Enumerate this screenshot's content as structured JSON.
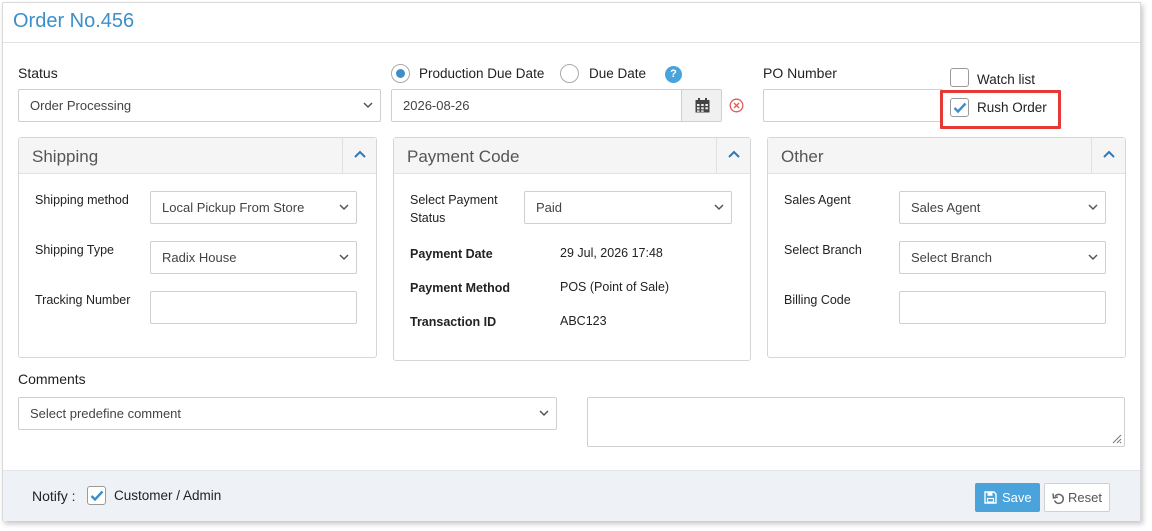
{
  "page": {
    "title": "Order No.456"
  },
  "status": {
    "label": "Status",
    "value": "Order Processing"
  },
  "due_date": {
    "option_production": "Production Due Date",
    "option_due": "Due Date",
    "selected": "production",
    "help": "?",
    "value": "2026-08-26"
  },
  "po": {
    "label": "PO Number",
    "value": ""
  },
  "flags": {
    "watch_list": {
      "label": "Watch list",
      "checked": false
    },
    "rush_order": {
      "label": "Rush Order",
      "checked": true
    }
  },
  "shipping": {
    "title": "Shipping",
    "method_label": "Shipping method",
    "method_value": "Local Pickup From Store",
    "type_label": "Shipping Type",
    "type_value": "Radix House",
    "tracking_label": "Tracking Number",
    "tracking_value": ""
  },
  "payment": {
    "title": "Payment Code",
    "status_label": "Select Payment Status",
    "status_value": "Paid",
    "date_label": "Payment Date",
    "date_value": "29 Jul, 2026 17:48",
    "method_label": "Payment Method",
    "method_value": "POS (Point of Sale)",
    "txn_label": "Transaction ID",
    "txn_value": "ABC123"
  },
  "other": {
    "title": "Other",
    "agent_label": "Sales Agent",
    "agent_value": "Sales Agent",
    "branch_label": "Select Branch",
    "branch_value": "Select Branch",
    "billing_label": "Billing Code",
    "billing_value": ""
  },
  "comments": {
    "label": "Comments",
    "predefined_value": "Select predefine comment",
    "text": ""
  },
  "footer": {
    "notify_label": "Notify :",
    "notify_option": "Customer / Admin",
    "notify_checked": true,
    "save_label": "Save",
    "reset_label": "Reset"
  },
  "colors": {
    "accent": "#3d8fc9",
    "button": "#4aa3db",
    "highlight": "#e53935"
  }
}
